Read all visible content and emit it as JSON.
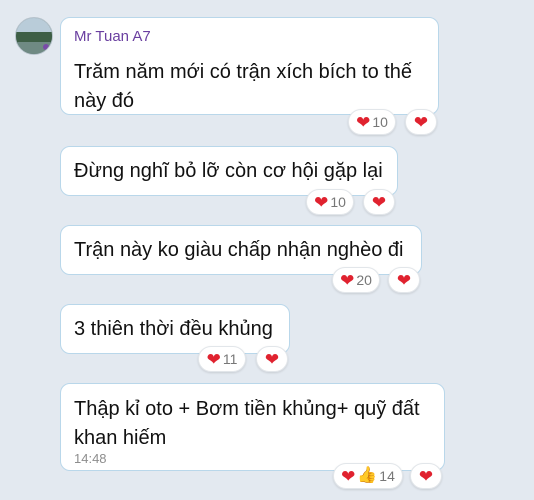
{
  "sender": {
    "name": "Mr Tuan A7"
  },
  "messages": [
    {
      "text": "Trăm năm mới có trận xích bích to thế này đó",
      "reaction_count": "10"
    },
    {
      "text": "Đừng nghĩ bỏ lỡ còn cơ hội gặp lại",
      "reaction_count": "10"
    },
    {
      "text": "Trận này ko giàu chấp nhận nghèo đi",
      "reaction_count": "20"
    },
    {
      "text": "3 thiên thời đều khủng",
      "reaction_count": "11"
    },
    {
      "text": "Thập kỉ oto + Bơm tiền khủng+ quỹ đất khan hiếm",
      "reaction_count": "14",
      "time": "14:48"
    }
  ],
  "icons": {
    "heart": "❤",
    "thumbs_up": "👍"
  },
  "colors": {
    "background": "#e3e9f0",
    "bubble_border": "#b9d7ea",
    "sender_name": "#6a3fa0",
    "heart": "#e0222f"
  }
}
